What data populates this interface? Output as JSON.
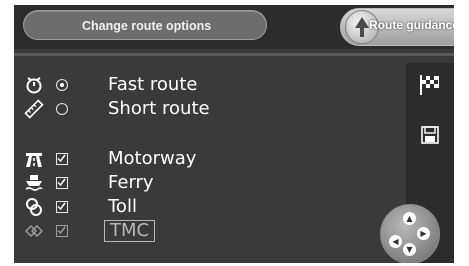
{
  "header": {
    "title": "Change route options",
    "guidance_label": "Route guidance"
  },
  "options": [
    {
      "label": "Fast route",
      "icon": "stopwatch-icon",
      "control": "radio",
      "selected": true
    },
    {
      "label": "Short route",
      "icon": "ruler-icon",
      "control": "radio",
      "selected": false
    },
    {
      "label": "Motorway",
      "icon": "motorway-icon",
      "control": "checkbox",
      "checked": true
    },
    {
      "label": "Ferry",
      "icon": "ferry-icon",
      "control": "checkbox",
      "checked": true
    },
    {
      "label": "Toll",
      "icon": "toll-icon",
      "control": "checkbox",
      "checked": true
    },
    {
      "label": "TMC",
      "icon": "tmc-icon",
      "control": "checkbox",
      "checked": true,
      "disabled": true
    }
  ],
  "side_panel": {
    "icons": [
      "checkered-flag-icon",
      "save-icon"
    ]
  },
  "colors": {
    "background": "#3a3a3a",
    "text": "#ffffff",
    "disabled_text": "#b7b7b7"
  }
}
